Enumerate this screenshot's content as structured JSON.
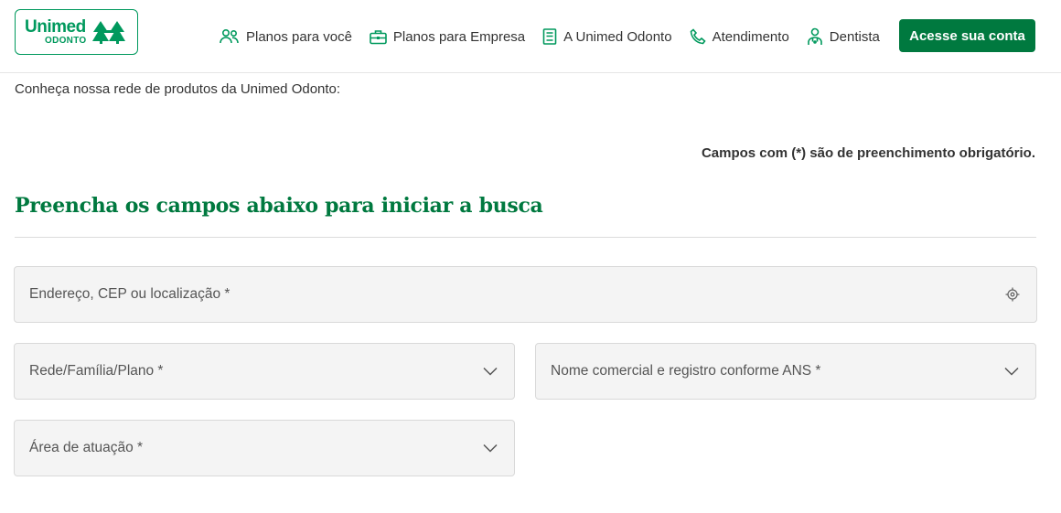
{
  "brand": {
    "name": "Unimed",
    "sub": "ODONTO",
    "color": "#00995d"
  },
  "nav": {
    "items": [
      {
        "label": "Planos para você",
        "icon": "people-icon"
      },
      {
        "label": "Planos para Empresa",
        "icon": "briefcase-icon"
      },
      {
        "label": "A Unimed Odonto",
        "icon": "book-icon"
      },
      {
        "label": "Atendimento",
        "icon": "phone-icon"
      },
      {
        "label": "Dentista",
        "icon": "dentist-icon"
      }
    ],
    "cta_label": "Acesse sua conta",
    "cta_color": "#00793f"
  },
  "page": {
    "intro": "Conheça nossa rede de produtos da Unimed Odonto:",
    "required_note": "Campos com (*) são de preenchimento obrigatório.",
    "form_title": "Preencha os campos abaixo para iniciar a busca"
  },
  "form": {
    "address_placeholder": "Endereço, CEP ou localização *",
    "address_icon": "location-target-icon",
    "rede_placeholder": "Rede/Família/Plano *",
    "nome_placeholder": "Nome comercial e registro conforme ANS *",
    "area_placeholder": "Área de atuação *",
    "select_icon": "chevron-down-icon"
  }
}
